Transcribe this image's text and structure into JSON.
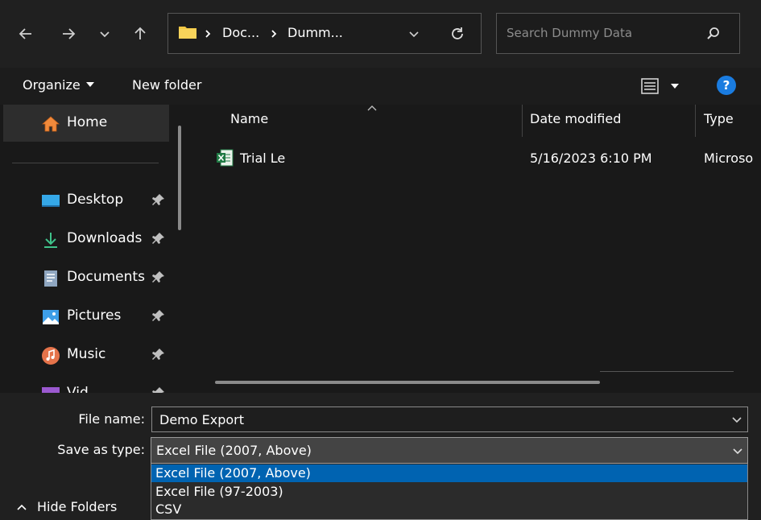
{
  "nav_buttons": {
    "back": "back-arrow-icon",
    "forward": "forward-arrow-icon",
    "recent": "chevron-down-icon",
    "up": "up-arrow-icon"
  },
  "address": {
    "segments": [
      "Doc...",
      "Dumm..."
    ],
    "icons": [
      "folder-icon",
      "chevron-right-icon",
      "chevron-down-icon",
      "refresh-icon"
    ]
  },
  "search": {
    "placeholder": "Search Dummy Data",
    "icon": "search-icon"
  },
  "commands": {
    "organize": "Organize",
    "new_folder": "New folder",
    "icons": [
      "view-options-icon",
      "help-icon"
    ]
  },
  "sidebar": {
    "home": "Home",
    "items": [
      {
        "label": "Desktop",
        "icon": "desktop-icon",
        "pinned": true
      },
      {
        "label": "Downloads",
        "icon": "download-icon",
        "pinned": true
      },
      {
        "label": "Documents",
        "icon": "document-icon",
        "pinned": true
      },
      {
        "label": "Pictures",
        "icon": "pictures-icon",
        "pinned": true
      },
      {
        "label": "Music",
        "icon": "music-icon",
        "pinned": true
      },
      {
        "label": "Vid...",
        "icon": "videos-icon",
        "pinned": true
      }
    ]
  },
  "columns": {
    "name": "Name",
    "date_modified": "Date modified",
    "type": "Type"
  },
  "files": [
    {
      "name": "Trial Le",
      "date_modified": "5/16/2023 6:10 PM",
      "type": "Microso",
      "icon": "excel-file-icon"
    }
  ],
  "form": {
    "file_name_label": "File name:",
    "file_name_value": "Demo Export",
    "save_as_type_label": "Save as type:",
    "save_as_type_value": "Excel File (2007, Above)",
    "type_options": [
      "Excel File (2007, Above)",
      "Excel File (97-2003)",
      "CSV"
    ],
    "selected_option_index": 0
  },
  "hide_folders": "Hide Folders",
  "colors": {
    "background": "#191919",
    "toolbar": "#202020",
    "accent": "#0063b1",
    "help_blue": "#1a7ce0",
    "folder_yellow": "#f2c744",
    "excel_green": "#1f7a44"
  }
}
